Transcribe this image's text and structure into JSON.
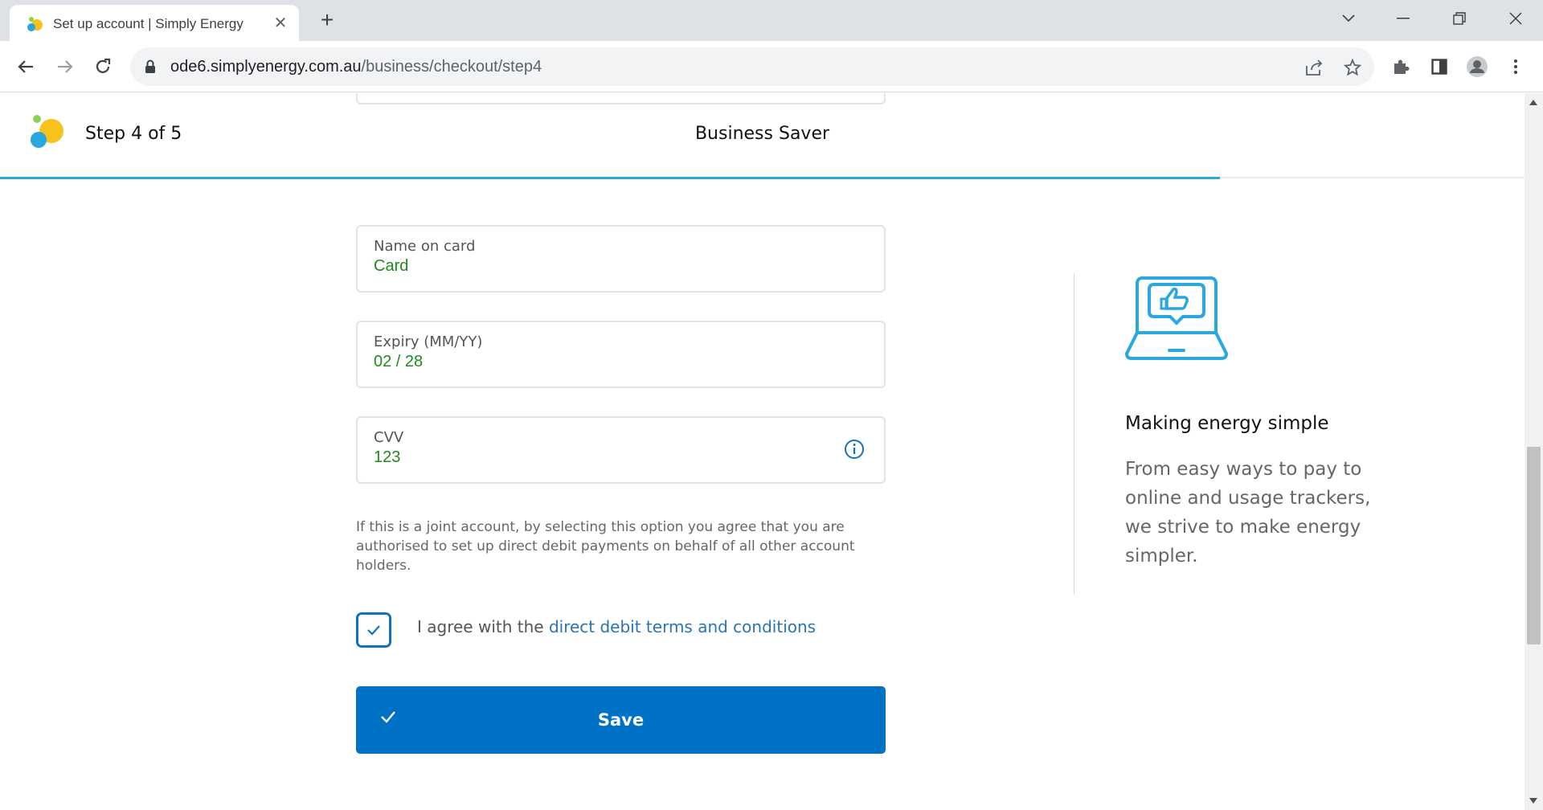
{
  "browser": {
    "tab_title": "Set up account | Simply Energy",
    "url_host": "ode6.simplyenergy.com.au",
    "url_path": "/business/checkout/step4"
  },
  "header": {
    "step_label": "Step 4 of 5",
    "plan_title": "Business Saver",
    "progress": 0.8
  },
  "form": {
    "name_on_card": {
      "label": "Name on card",
      "value": "Card"
    },
    "expiry": {
      "label": "Expiry (MM/YY)",
      "value": "02 / 28"
    },
    "cvv": {
      "label": "CVV",
      "value": "123"
    },
    "disclaimer": "If this is a joint account, by selecting this option you agree that you are authorised to set up direct debit payments on behalf of all other account holders.",
    "agree_prefix": "I agree with the ",
    "agree_link": "direct debit terms and conditions",
    "agree_checked": true,
    "save_label": "Save"
  },
  "promo": {
    "title": "Making energy simple",
    "text": "From easy ways to pay to online and usage trackers, we strive to make energy simpler."
  },
  "colors": {
    "accent": "#0072c6",
    "progress": "#29a7df",
    "value_text": "#1e8a1e",
    "link": "#2a74b4"
  }
}
